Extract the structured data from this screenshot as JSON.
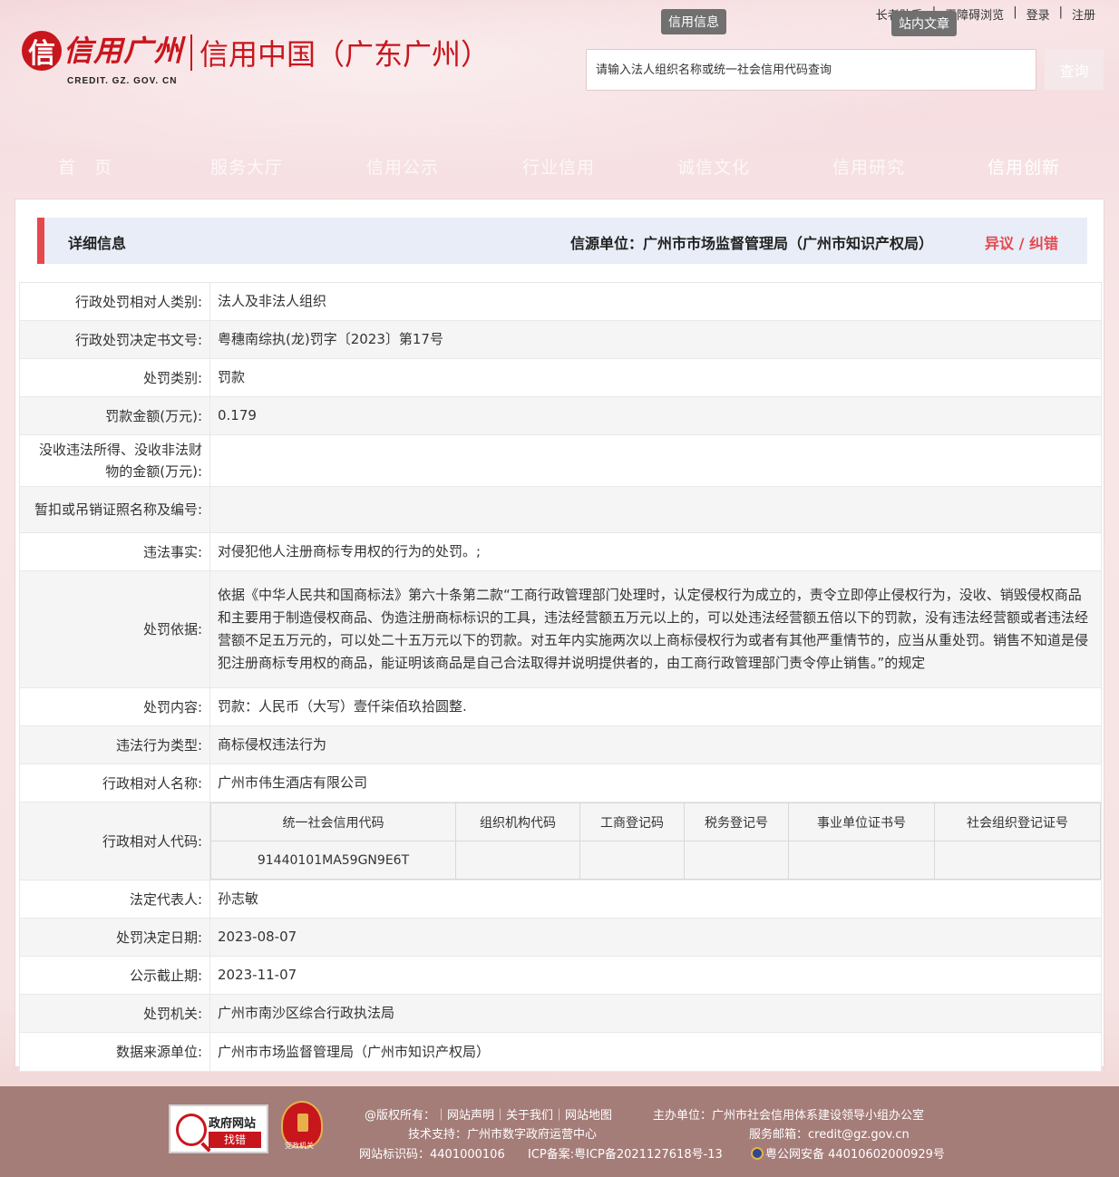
{
  "header": {
    "logo_main": "信用广州",
    "logo_glyph": "信",
    "logo_sub": "CREDIT. GZ. GOV. CN",
    "logo_second": "信用中国（广东广州）",
    "tooltip_credit": "信用信息",
    "tooltip_site": "站内文章",
    "toplinks": [
      "长者助手",
      "无障碍浏览",
      "登录",
      "注册"
    ],
    "search_placeholder": "请输入法人组织名称或统一社会信用代码查询",
    "search_button": "查询"
  },
  "nav": [
    "首　页",
    "服务大厅",
    "信用公示",
    "行业信用",
    "诚信文化",
    "信用研究",
    "信用创新"
  ],
  "detail": {
    "title": "详细信息",
    "source": "信源单位：广州市市场监督管理局（广州市知识产权局）",
    "objection": "异议 / 纠错"
  },
  "rows": [
    {
      "label": "行政处罚相对人类别:",
      "value": "法人及非法人组织"
    },
    {
      "label": "行政处罚决定书文号:",
      "value": "粤穗南综执(龙)罚字〔2023〕第17号"
    },
    {
      "label": "处罚类别:",
      "value": "罚款"
    },
    {
      "label": "罚款金额(万元):",
      "value": "0.179"
    },
    {
      "label": "没收违法所得、没收非法财物的金额(万元):",
      "value": ""
    },
    {
      "label": "暂扣或吊销证照名称及编号:",
      "value": ""
    },
    {
      "label": "违法事实:",
      "value": "对侵犯他人注册商标专用权的行为的处罚。;"
    },
    {
      "label": "处罚依据:",
      "value": "依据《中华人民共和国商标法》第六十条第二款“工商行政管理部门处理时，认定侵权行为成立的，责令立即停止侵权行为，没收、销毁侵权商品和主要用于制造侵权商品、伪造注册商标标识的工具，违法经营额五万元以上的，可以处违法经营额五倍以下的罚款，没有违法经营额或者违法经营额不足五万元的，可以处二十五万元以下的罚款。对五年内实施两次以上商标侵权行为或者有其他严重情节的，应当从重处罚。销售不知道是侵犯注册商标专用权的商品，能证明该商品是自己合法取得并说明提供者的，由工商行政管理部门责令停止销售。”的规定"
    },
    {
      "label": "处罚内容:",
      "value": "罚款：人民币（大写）壹仟柒佰玖拾圆整."
    },
    {
      "label": "违法行为类型:",
      "value": "商标侵权违法行为"
    },
    {
      "label": "行政相对人名称:",
      "value": "广州市伟生酒店有限公司"
    }
  ],
  "codes": {
    "label": "行政相对人代码:",
    "headers": [
      "统一社会信用代码",
      "组织机构代码",
      "工商登记码",
      "税务登记号",
      "事业单位证书号",
      "社会组织登记证号"
    ],
    "values": [
      "91440101MA59GN9E6T",
      "",
      "",
      "",
      "",
      ""
    ]
  },
  "rows2": [
    {
      "label": "法定代表人:",
      "value": "孙志敏"
    },
    {
      "label": "处罚决定日期:",
      "value": "2023-08-07"
    },
    {
      "label": "公示截止期:",
      "value": "2023-11-07"
    },
    {
      "label": "处罚机关:",
      "value": "广州市南沙区综合行政执法局"
    },
    {
      "label": "数据来源单位:",
      "value": "广州市市场监督管理局（广州市知识产权局）"
    }
  ],
  "footer": {
    "gov_badge_top": "政府网站",
    "gov_badge_bottom": "找错",
    "party_badge": "党政机关",
    "copyright": "@版权所有：｜网站声明｜关于我们｜网站地图",
    "sponsor": "主办单位：广州市社会信用体系建设领导小组办公室",
    "support": "技术支持：广州市数字政府运营中心",
    "email": "服务邮箱：credit@gz.gov.cn",
    "site_id": "网站标识码：4401000106",
    "icp": "ICP备案:粤ICP备2021127618号-13",
    "police": "粤公网安备 44010602000929号"
  }
}
